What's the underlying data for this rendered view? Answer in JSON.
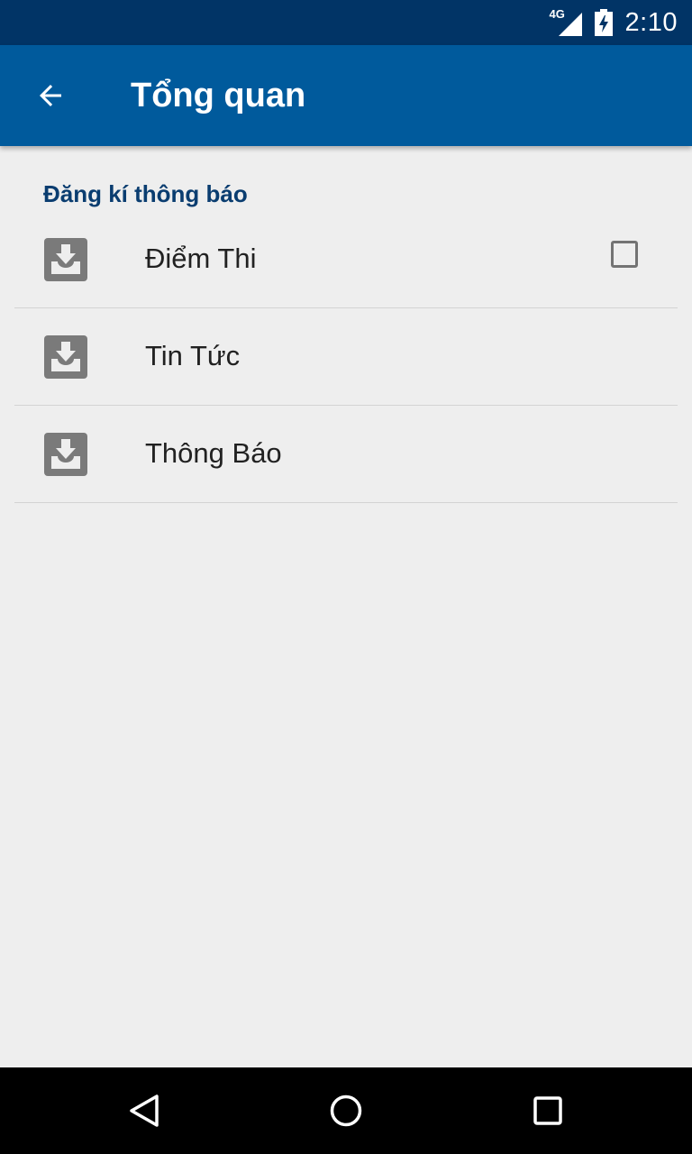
{
  "status_bar": {
    "network_type": "4G",
    "time": "2:10",
    "signal_icon": "signal-strength-icon",
    "battery_icon": "battery-charging-icon"
  },
  "app_bar": {
    "back_icon": "arrow-back-icon",
    "title": "Tổng quan",
    "color": "#005a9c"
  },
  "section": {
    "header": "Đăng kí thông báo",
    "items": [
      {
        "label": "Điểm Thi",
        "icon": "download-tray-icon",
        "checked": false,
        "has_checkbox": true
      },
      {
        "label": "Tin Tức",
        "icon": "download-tray-icon",
        "has_checkbox": false
      },
      {
        "label": "Thông Báo",
        "icon": "download-tray-icon",
        "has_checkbox": false
      }
    ]
  },
  "nav_bar": {
    "back_icon": "nav-back-triangle-icon",
    "home_icon": "nav-home-circle-icon",
    "recents_icon": "nav-recents-square-icon"
  },
  "colors": {
    "status_bar": "#013466",
    "app_bar": "#005a9c",
    "section_header": "#0a3d70",
    "background": "#eeeeee",
    "icon_gray": "#7a7a7a"
  }
}
